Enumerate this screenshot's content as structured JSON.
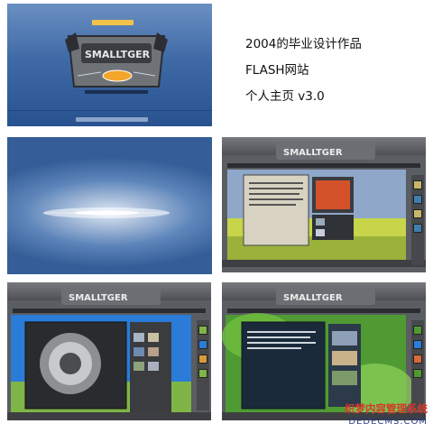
{
  "captions": {
    "line1": "2004的毕业设计作品",
    "line2": "FLASH网站",
    "line3": "个人主页 v3.0"
  },
  "watermark": {
    "line1": "织梦内容管理系统",
    "line2": "DEDECMS.COM"
  },
  "screens": [
    {
      "name": "intro-screen",
      "colors": {
        "bg_top": "#6a8fc2",
        "bg_bottom": "#27528f",
        "accent": "#f2c24a"
      },
      "logo_text": "SMALLTGER"
    },
    {
      "name": "loading-screen",
      "colors": {
        "center": "#dfe8f4",
        "edge": "#355e98"
      }
    },
    {
      "name": "page-about",
      "colors": {
        "frame": "#5a5d62",
        "field": "#c8d44a",
        "sky": "#8fa8c9"
      }
    },
    {
      "name": "page-gallery",
      "colors": {
        "frame": "#5a5d62",
        "sky": "#2b7bd8",
        "grass": "#7fb447"
      }
    },
    {
      "name": "page-guestbook",
      "colors": {
        "frame": "#5a5d62",
        "foliage": "#4f9a33",
        "panel": "#1b2a3a"
      }
    }
  ]
}
